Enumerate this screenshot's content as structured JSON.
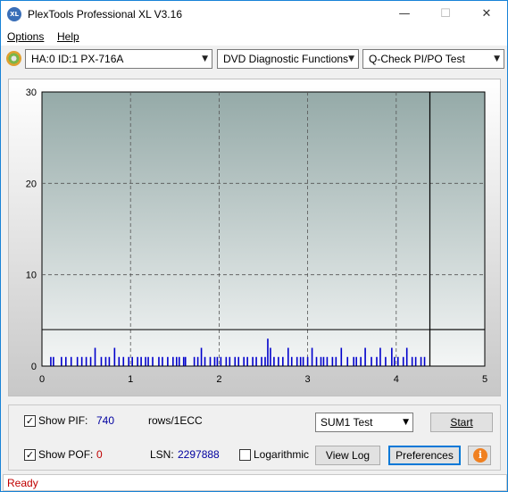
{
  "window": {
    "title": "PlexTools Professional XL V3.16",
    "icon_label": "XL"
  },
  "menu": {
    "items": [
      "Options",
      "Help"
    ]
  },
  "toolbar": {
    "drive": "HA:0 ID:1  PX-716A",
    "function": "DVD Diagnostic Functions",
    "test": "Q-Check PI/PO Test"
  },
  "chart_data": {
    "type": "bar",
    "title": "",
    "xlabel": "",
    "ylabel": "",
    "xlim": [
      0,
      5
    ],
    "ylim": [
      0,
      30
    ],
    "x_ticks": [
      "0",
      "1",
      "2",
      "3",
      "4",
      "5"
    ],
    "y_ticks": [
      "0",
      "10",
      "20",
      "30"
    ],
    "threshold_line": 4,
    "end_marker_x": 4.38,
    "grid": true,
    "series": [
      {
        "color": "#0000cc",
        "x": [
          0.1,
          0.13,
          0.22,
          0.27,
          0.33,
          0.4,
          0.45,
          0.5,
          0.55,
          0.6,
          0.67,
          0.72,
          0.76,
          0.82,
          0.87,
          0.92,
          0.98,
          1.02,
          1.08,
          1.12,
          1.17,
          1.2,
          1.25,
          1.32,
          1.36,
          1.42,
          1.48,
          1.52,
          1.55,
          1.6,
          1.62,
          1.72,
          1.76,
          1.8,
          1.84,
          1.9,
          1.95,
          1.98,
          2.02,
          2.08,
          2.12,
          2.18,
          2.22,
          2.28,
          2.32,
          2.38,
          2.42,
          2.48,
          2.52,
          2.55,
          2.58,
          2.62,
          2.67,
          2.72,
          2.78,
          2.82,
          2.88,
          2.92,
          2.95,
          3.0,
          3.05,
          3.1,
          3.15,
          3.18,
          3.22,
          3.28,
          3.32,
          3.38,
          3.45,
          3.52,
          3.55,
          3.6,
          3.65,
          3.72,
          3.78,
          3.82,
          3.88,
          3.95,
          3.98,
          4.02,
          4.08,
          4.12,
          4.18,
          4.22,
          4.28,
          4.32
        ],
        "values": [
          1,
          1,
          1,
          1,
          1,
          1,
          1,
          1,
          1,
          2,
          1,
          1,
          1,
          2,
          1,
          1,
          1,
          1,
          1,
          1,
          1,
          1,
          1,
          1,
          1,
          1,
          1,
          1,
          1,
          1,
          1,
          1,
          1,
          2,
          1,
          1,
          1,
          1,
          1,
          1,
          1,
          1,
          1,
          1,
          1,
          1,
          1,
          1,
          1,
          3,
          2,
          1,
          1,
          1,
          2,
          1,
          1,
          1,
          1,
          1,
          2,
          1,
          1,
          1,
          1,
          1,
          1,
          2,
          1,
          1,
          1,
          1,
          2,
          1,
          1,
          2,
          1,
          2,
          1,
          1,
          1,
          2,
          1,
          1,
          1,
          1
        ]
      }
    ]
  },
  "controls": {
    "show_pif_label": "Show PIF:",
    "pif_value": "740",
    "pif_unit": "rows/1ECC",
    "show_pof_label": "Show POF:",
    "pof_value": "0",
    "lsn_label": "LSN:",
    "lsn_value": "2297888",
    "logarithmic_label": "Logarithmic",
    "sum_select": "SUM1 Test",
    "start_label": "Start",
    "view_log_label": "View Log",
    "preferences_label": "Preferences",
    "checkmark": "✓",
    "info_glyph": "i"
  },
  "status": {
    "text": "Ready"
  },
  "colors": {
    "plot_top": "#95aaa8",
    "plot_bottom": "#f4f6f6",
    "bar": "#0000cc",
    "status_red": "#c00000",
    "value_blue": "#0000a0"
  }
}
